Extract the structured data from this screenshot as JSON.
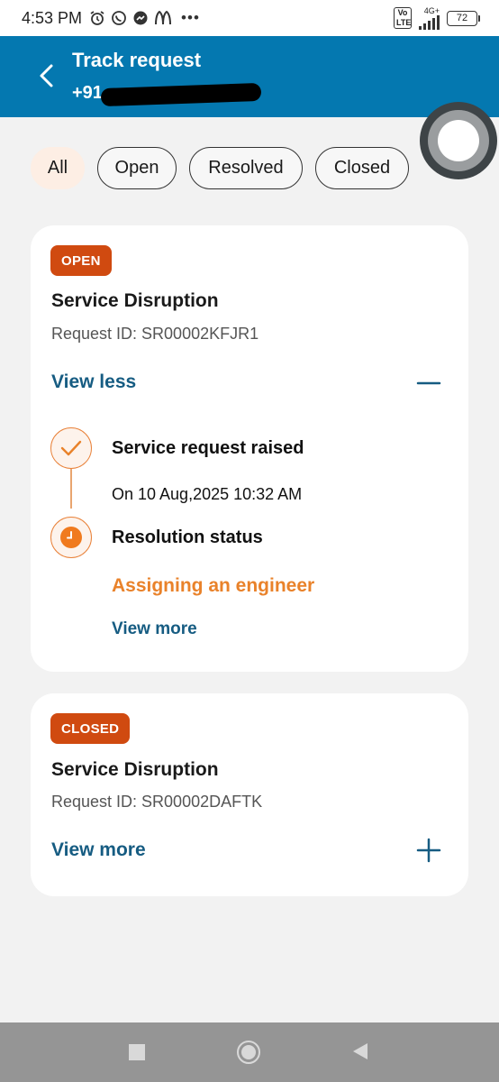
{
  "status_bar": {
    "time": "4:53 PM",
    "notification_icons": [
      "alarm-icon",
      "whatsapp-icon",
      "messenger-icon",
      "mcdonalds-icon",
      "more-icon"
    ],
    "volte": "Vo LTE",
    "network": "4G+",
    "battery": "72"
  },
  "header": {
    "title": "Track request",
    "phone_prefix": "+91"
  },
  "filters": [
    {
      "label": "All",
      "active": true
    },
    {
      "label": "Open",
      "active": false
    },
    {
      "label": "Resolved",
      "active": false
    },
    {
      "label": "Closed",
      "active": false
    }
  ],
  "requests": [
    {
      "status": "OPEN",
      "title": "Service Disruption",
      "request_id": "Request ID: SR00002KFJR1",
      "toggle_label": "View less",
      "expanded": true,
      "timeline": {
        "step1_title": "Service request raised",
        "step1_sub": "On 10 Aug,2025 10:32 AM",
        "step2_title": "Resolution status",
        "step2_status": "Assigning an engineer",
        "view_more": "View more"
      }
    },
    {
      "status": "CLOSED",
      "title": "Service Disruption",
      "request_id": "Request ID: SR00002DAFTK",
      "toggle_label": "View more",
      "expanded": false
    }
  ],
  "colors": {
    "header": "#0478b0",
    "badge": "#d04a10",
    "link": "#165c82",
    "accent": "#e9822a"
  }
}
